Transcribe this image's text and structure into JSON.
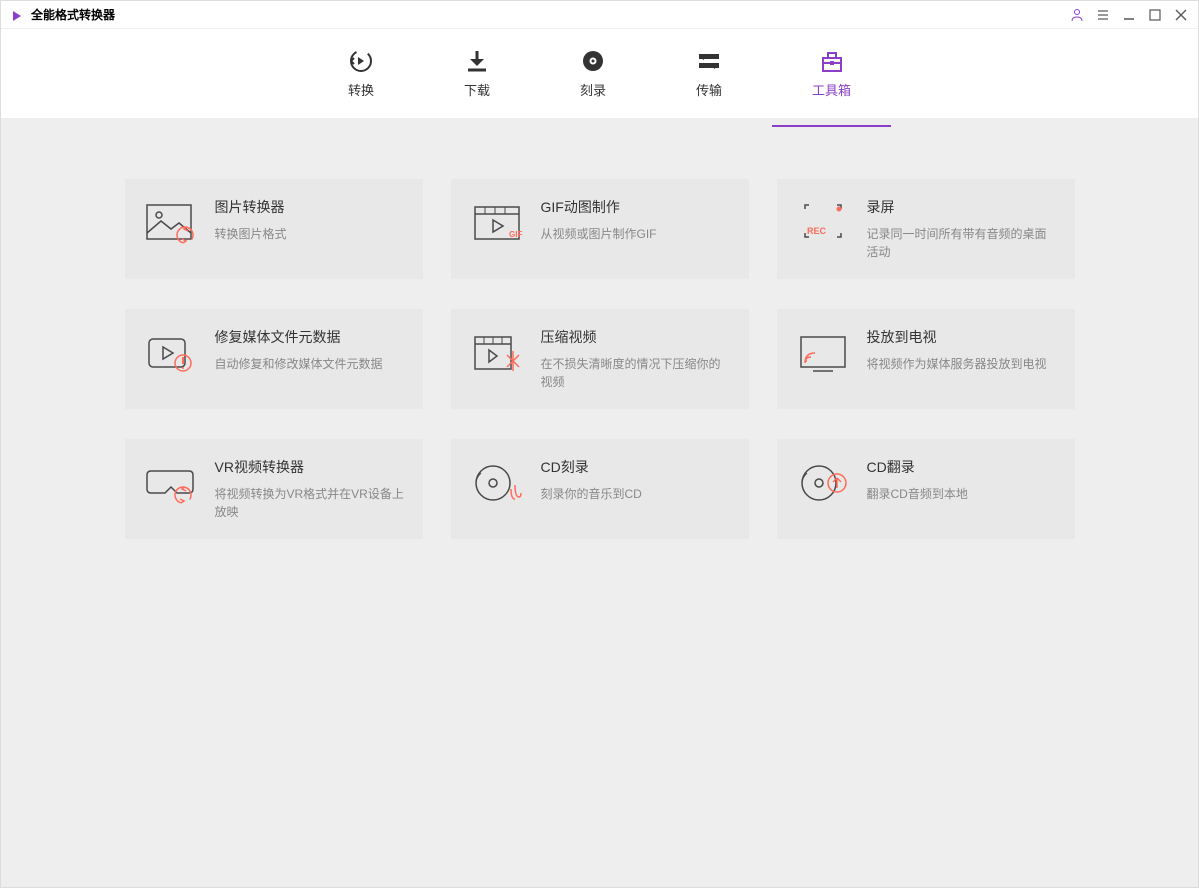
{
  "app": {
    "title": "全能格式转换器"
  },
  "nav": {
    "items": [
      {
        "label": "转换"
      },
      {
        "label": "下载"
      },
      {
        "label": "刻录"
      },
      {
        "label": "传输"
      },
      {
        "label": "工具箱"
      }
    ]
  },
  "tools": [
    {
      "title": "图片转换器",
      "desc": "转换图片格式"
    },
    {
      "title": "GIF动图制作",
      "desc": "从视频或图片制作GIF"
    },
    {
      "title": "录屏",
      "desc": "记录同一时间所有带有音频的桌面活动"
    },
    {
      "title": "修复媒体文件元数据",
      "desc": "自动修复和修改媒体文件元数据"
    },
    {
      "title": "压缩视频",
      "desc": "在不损失清晰度的情况下压缩你的视频"
    },
    {
      "title": "投放到电视",
      "desc": "将视频作为媒体服务器投放到电视"
    },
    {
      "title": "VR视频转换器",
      "desc": "将视频转换为VR格式并在VR设备上放映"
    },
    {
      "title": "CD刻录",
      "desc": "刻录你的音乐到CD"
    },
    {
      "title": "CD翻录",
      "desc": "翻录CD音频到本地"
    }
  ]
}
